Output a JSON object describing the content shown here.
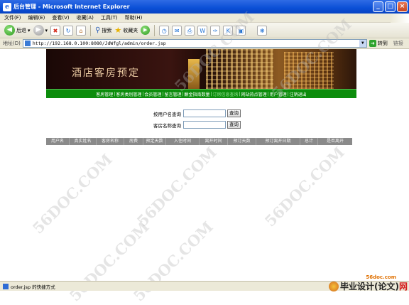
{
  "window": {
    "title": "后台管理 - Microsoft Internet Explorer",
    "controls": [
      "_",
      "□",
      "×"
    ]
  },
  "menubar": [
    "文件(F)",
    "编辑(E)",
    "查看(V)",
    "收藏(A)",
    "工具(T)",
    "帮助(H)"
  ],
  "toolbar": {
    "back": "后退",
    "search": "搜索",
    "favorites": "收藏夹"
  },
  "address": {
    "label": "地址(D)",
    "url": "http://192.168.0.100:8080/JdWfgl/admin/order.jsp",
    "go": "转到",
    "links": "链接"
  },
  "banner": {
    "title": "酒店客房预定"
  },
  "nav": [
    "客房管理",
    "客房类别管理",
    "会员管理",
    "留言管理",
    "酬金指南数量",
    "订房信息查询",
    "网站热点管理",
    "用户管理",
    "注销退出"
  ],
  "nav_current_index": 5,
  "search": {
    "by_username_label": "按用户名查询",
    "by_roomname_label": "客房名称查询",
    "button": "查询"
  },
  "table": {
    "headers": [
      "用户名",
      "真实姓名",
      "客房名称",
      "房费",
      "预定天数",
      "入住时间",
      "离开时间",
      "预订天数",
      "预订离开日期",
      "总计",
      "是否离开"
    ]
  },
  "watermark": "56DOC.COM",
  "statusbar": {
    "text": "order.jsp  的快捷方式"
  },
  "brand": {
    "site": "56doc.com",
    "name_main": "毕业设计",
    "name_paren": "(论文)",
    "name_end": "网"
  }
}
